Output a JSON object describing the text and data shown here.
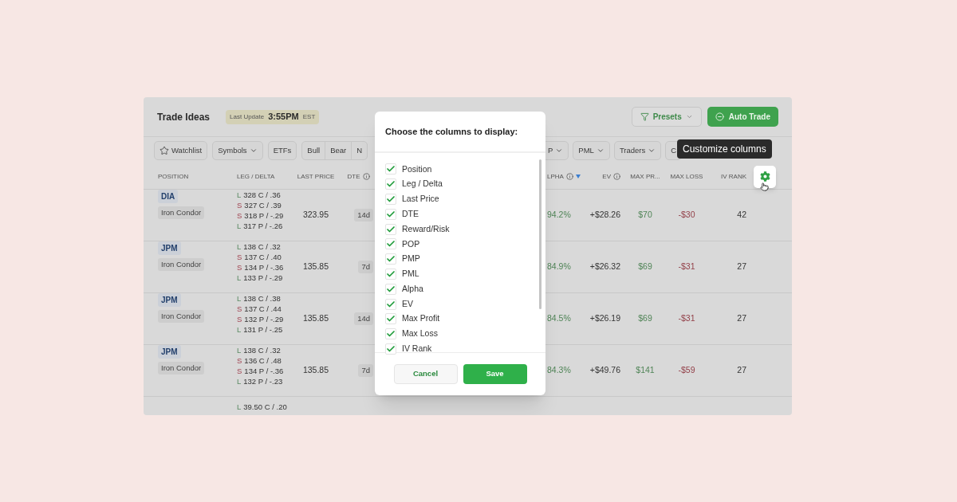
{
  "panel": {
    "title": "Trade Ideas",
    "last_update": {
      "label": "Last Update",
      "time": "3:55PM",
      "zone": "EST"
    },
    "buttons": [
      {
        "label": "Presets",
        "kind": "outline"
      },
      {
        "label": "Auto Trade",
        "kind": "primary"
      }
    ]
  },
  "filters": {
    "left": [
      {
        "kind": "watchlist",
        "label": "Watchlist"
      },
      {
        "kind": "dropdown",
        "label": "Symbols"
      },
      {
        "kind": "plain",
        "label": "ETFs"
      },
      {
        "kind": "segmented",
        "options": [
          "Bull",
          "Bear",
          "N"
        ]
      }
    ],
    "right": [
      {
        "kind": "dropdown",
        "label": "P"
      },
      {
        "kind": "dropdown",
        "label": "PML"
      },
      {
        "kind": "dropdown",
        "label": "Traders"
      },
      {
        "kind": "plain",
        "label": "C"
      }
    ]
  },
  "table": {
    "columns": [
      {
        "label": "POSITION",
        "info": false,
        "sorted": false
      },
      {
        "label": "LEG / DELTA",
        "info": false,
        "sorted": false
      },
      {
        "label": "LAST PRICE",
        "info": false,
        "sorted": false
      },
      {
        "label": "DTE",
        "info": true,
        "sorted": false
      },
      {
        "label": "LPHA",
        "info": true,
        "sorted": true
      },
      {
        "label": "EV",
        "info": true,
        "sorted": false
      },
      {
        "label": "MAX PR...",
        "info": false,
        "sorted": false
      },
      {
        "label": "MAX LOSS",
        "info": false,
        "sorted": false
      },
      {
        "label": "IV RANK",
        "info": false,
        "sorted": false
      }
    ],
    "rows": [
      {
        "symbol": "DIA",
        "strategy": "Iron Condor",
        "legs": [
          {
            "side": "L",
            "kind": "long",
            "text": "328 C / .36"
          },
          {
            "side": "S",
            "kind": "short",
            "text": "327 C / .39"
          },
          {
            "side": "S",
            "kind": "short",
            "text": "318 P / -.29"
          },
          {
            "side": "L",
            "kind": "long",
            "text": "317 P / -.26"
          }
        ],
        "last_price": "323.95",
        "dte": "14d",
        "alpha": "94.2%",
        "ev": "+$28.26",
        "max_profit": "$70",
        "max_loss": "-$30",
        "iv_rank": "42"
      },
      {
        "symbol": "JPM",
        "strategy": "Iron Condor",
        "legs": [
          {
            "side": "L",
            "kind": "long",
            "text": "138 C / .32"
          },
          {
            "side": "S",
            "kind": "short",
            "text": "137 C / .40"
          },
          {
            "side": "S",
            "kind": "short",
            "text": "134 P / -.36"
          },
          {
            "side": "L",
            "kind": "long",
            "text": "133 P / -.29"
          }
        ],
        "last_price": "135.85",
        "dte": "7d",
        "alpha": "84.9%",
        "ev": "+$26.32",
        "max_profit": "$69",
        "max_loss": "-$31",
        "iv_rank": "27"
      },
      {
        "symbol": "JPM",
        "strategy": "Iron Condor",
        "legs": [
          {
            "side": "L",
            "kind": "long",
            "text": "138 C / .38"
          },
          {
            "side": "S",
            "kind": "short",
            "text": "137 C / .44"
          },
          {
            "side": "S",
            "kind": "short",
            "text": "132 P / -.29"
          },
          {
            "side": "L",
            "kind": "long",
            "text": "131 P / -.25"
          }
        ],
        "last_price": "135.85",
        "dte": "14d",
        "alpha": "84.5%",
        "ev": "+$26.19",
        "max_profit": "$69",
        "max_loss": "-$31",
        "iv_rank": "27"
      },
      {
        "symbol": "JPM",
        "strategy": "Iron Condor",
        "legs": [
          {
            "side": "L",
            "kind": "long",
            "text": "138 C / .32"
          },
          {
            "side": "S",
            "kind": "short",
            "text": "136 C / .48"
          },
          {
            "side": "S",
            "kind": "short",
            "text": "134 P / -.36"
          },
          {
            "side": "L",
            "kind": "long",
            "text": "132 P / -.23"
          }
        ],
        "last_price": "135.85",
        "dte": "7d",
        "alpha": "84.3%",
        "ev": "+$49.76",
        "max_profit": "$141",
        "max_loss": "-$59",
        "iv_rank": "27"
      },
      {
        "legs": [
          {
            "side": "L",
            "kind": "long",
            "text": "39.50 C / .20"
          }
        ]
      }
    ]
  },
  "tooltip": {
    "text": "Customize columns"
  },
  "modal": {
    "title": "Choose the columns to display:",
    "options": [
      {
        "label": "Position",
        "checked": true
      },
      {
        "label": "Leg / Delta",
        "checked": true
      },
      {
        "label": "Last Price",
        "checked": true
      },
      {
        "label": "DTE",
        "checked": true
      },
      {
        "label": "Reward/Risk",
        "checked": true
      },
      {
        "label": "POP",
        "checked": true
      },
      {
        "label": "PMP",
        "checked": true
      },
      {
        "label": "PML",
        "checked": true
      },
      {
        "label": "Alpha",
        "checked": true
      },
      {
        "label": "EV",
        "checked": true
      },
      {
        "label": "Max Profit",
        "checked": true
      },
      {
        "label": "Max Loss",
        "checked": true
      },
      {
        "label": "IV Rank",
        "checked": true
      }
    ],
    "buttons": [
      {
        "label": "Cancel",
        "kind": "secondary"
      },
      {
        "label": "Save",
        "kind": "primary"
      }
    ]
  }
}
